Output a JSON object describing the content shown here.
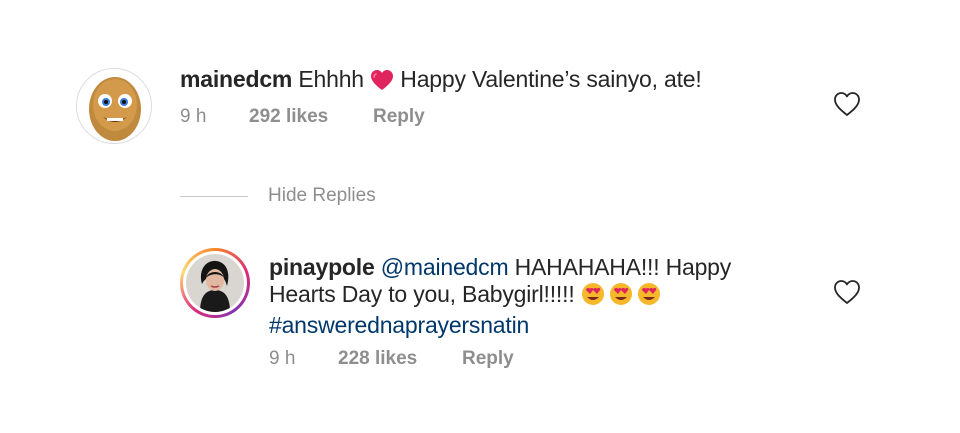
{
  "comments": [
    {
      "username": "mainedcm",
      "text_before_emoji": "Ehhhh",
      "emoji_name": "red-heart",
      "text_after_emoji": "Happy Valentine’s sainyo, ate!",
      "time": "9 h",
      "likes": "292 likes",
      "reply": "Reply",
      "avatar_icon": "potato-face-avatar"
    }
  ],
  "toggle": {
    "label": "Hide Replies"
  },
  "replies": [
    {
      "username": "pinaypole",
      "mention": "@mainedcm",
      "text_line1": "HAHAHAHA!!! Happy",
      "text_line2": "Hearts Day to you, Babygirl!!!!!",
      "emoji_name": "heart-eyes-face",
      "hashtag": "#answerednaprayersnatin",
      "time": "9 h",
      "likes": "228 likes",
      "reply": "Reply",
      "avatar_icon": "woman-portrait-avatar"
    }
  ],
  "colors": {
    "text": "#262626",
    "muted": "#8e8e8e",
    "link": "#00376b",
    "heart_emoji": "#e0245e"
  }
}
